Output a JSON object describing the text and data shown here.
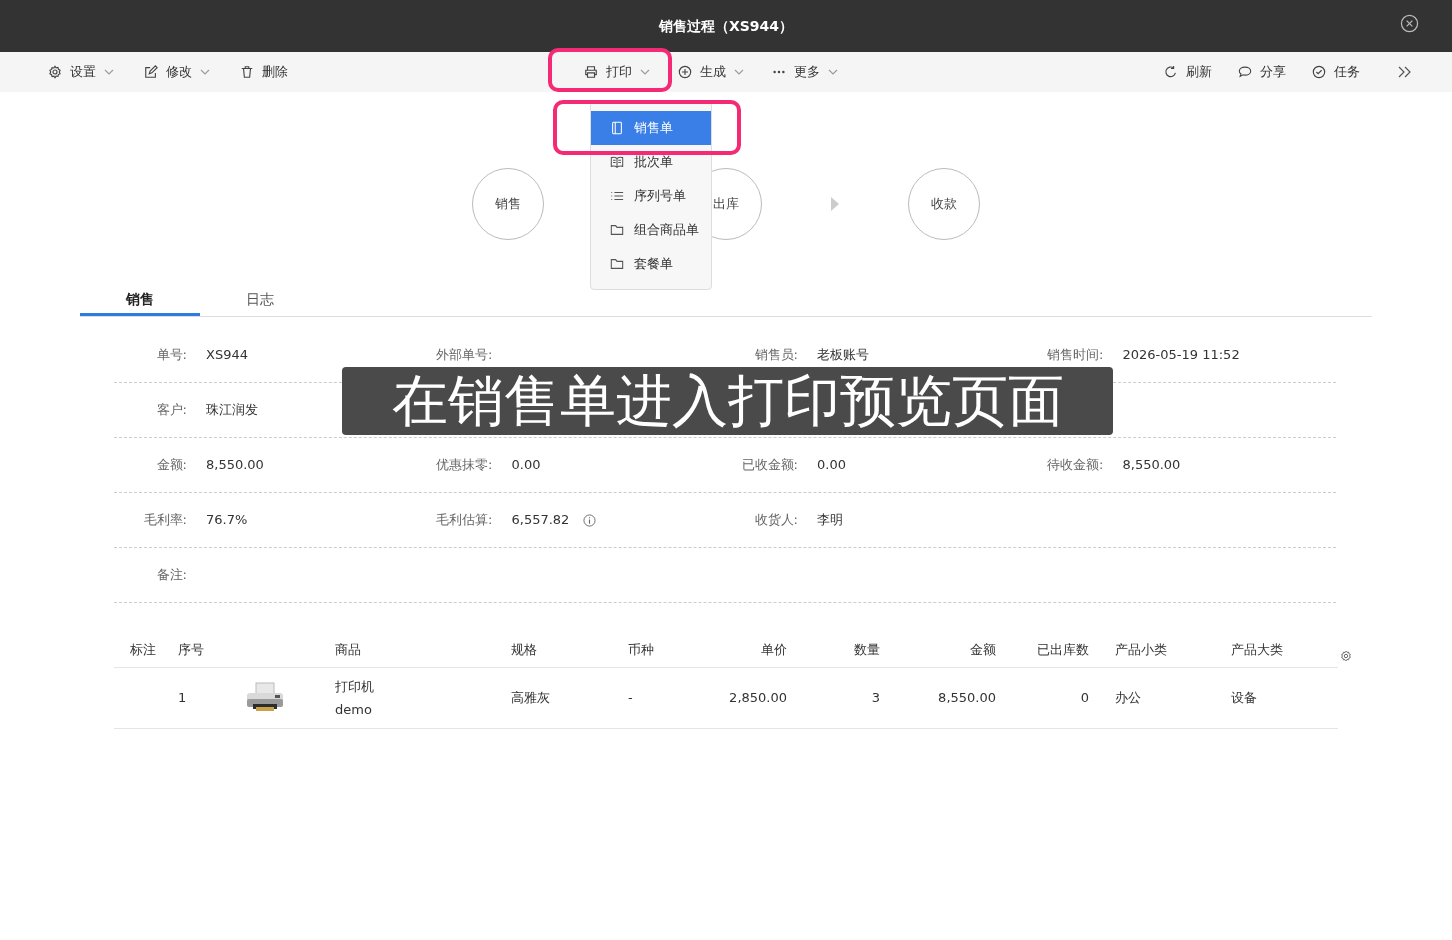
{
  "window": {
    "title": "销售过程（XS944）"
  },
  "toolbar": {
    "left": [
      {
        "label": "设置",
        "has_menu": true
      },
      {
        "label": "修改",
        "has_menu": true
      },
      {
        "label": "删除",
        "has_menu": false
      }
    ],
    "center": [
      {
        "label": "打印",
        "has_menu": true
      },
      {
        "label": "生成",
        "has_menu": true
      },
      {
        "label": "更多",
        "has_menu": true
      }
    ],
    "right": [
      {
        "label": "刷新"
      },
      {
        "label": "分享"
      },
      {
        "label": "任务"
      }
    ]
  },
  "print_menu": [
    {
      "label": "销售单",
      "selected": true
    },
    {
      "label": "批次单",
      "selected": false
    },
    {
      "label": "序列号单",
      "selected": false
    },
    {
      "label": "组合商品单",
      "selected": false
    },
    {
      "label": "套餐单",
      "selected": false
    }
  ],
  "flow": [
    {
      "label": "销售"
    },
    {
      "label": "出库"
    },
    {
      "label": "收款"
    }
  ],
  "tabs": [
    {
      "label": "销售",
      "selected": true
    },
    {
      "label": "日志",
      "selected": false
    }
  ],
  "form_rows": [
    [
      {
        "label": "单号:",
        "value": "XS944"
      },
      {
        "label": "外部单号:"
      },
      {
        "label": "销售员:",
        "value": "老板账号"
      },
      {
        "label": "销售时间:",
        "value": "2026-05-19 11:52"
      }
    ],
    [
      {
        "label": "客户:",
        "value": "珠江润发"
      }
    ],
    [
      {
        "label": "金额:",
        "value": "8,550.00"
      },
      {
        "label": "优惠抹零:",
        "value": "0.00"
      },
      {
        "label": "已收金额:",
        "value": "0.00"
      },
      {
        "label": "待收金额:",
        "value": "8,550.00"
      }
    ],
    [
      {
        "label": "毛利率:",
        "value": "76.7%"
      },
      {
        "label": "毛利估算:",
        "value": "6,557.82",
        "info": true
      },
      {
        "label": "收货人:",
        "value": "李明"
      }
    ],
    [
      {
        "label": "备注:"
      }
    ]
  ],
  "table": {
    "columns": [
      "标注",
      "序号",
      "商品",
      "规格",
      "币种",
      "单价",
      "数量",
      "金额",
      "已出库数",
      "产品小类",
      "产品大类"
    ],
    "rows": [
      {
        "index": "1",
        "product": "打印机",
        "product_code": "demo",
        "spec": "高雅灰",
        "currency": "-",
        "price": "2,850.00",
        "quantity": "3",
        "amount": "8,550.00",
        "shipped": "0",
        "subcategory": "办公",
        "category": "设备"
      }
    ]
  },
  "caption": "在销售单进入打印预览页面"
}
